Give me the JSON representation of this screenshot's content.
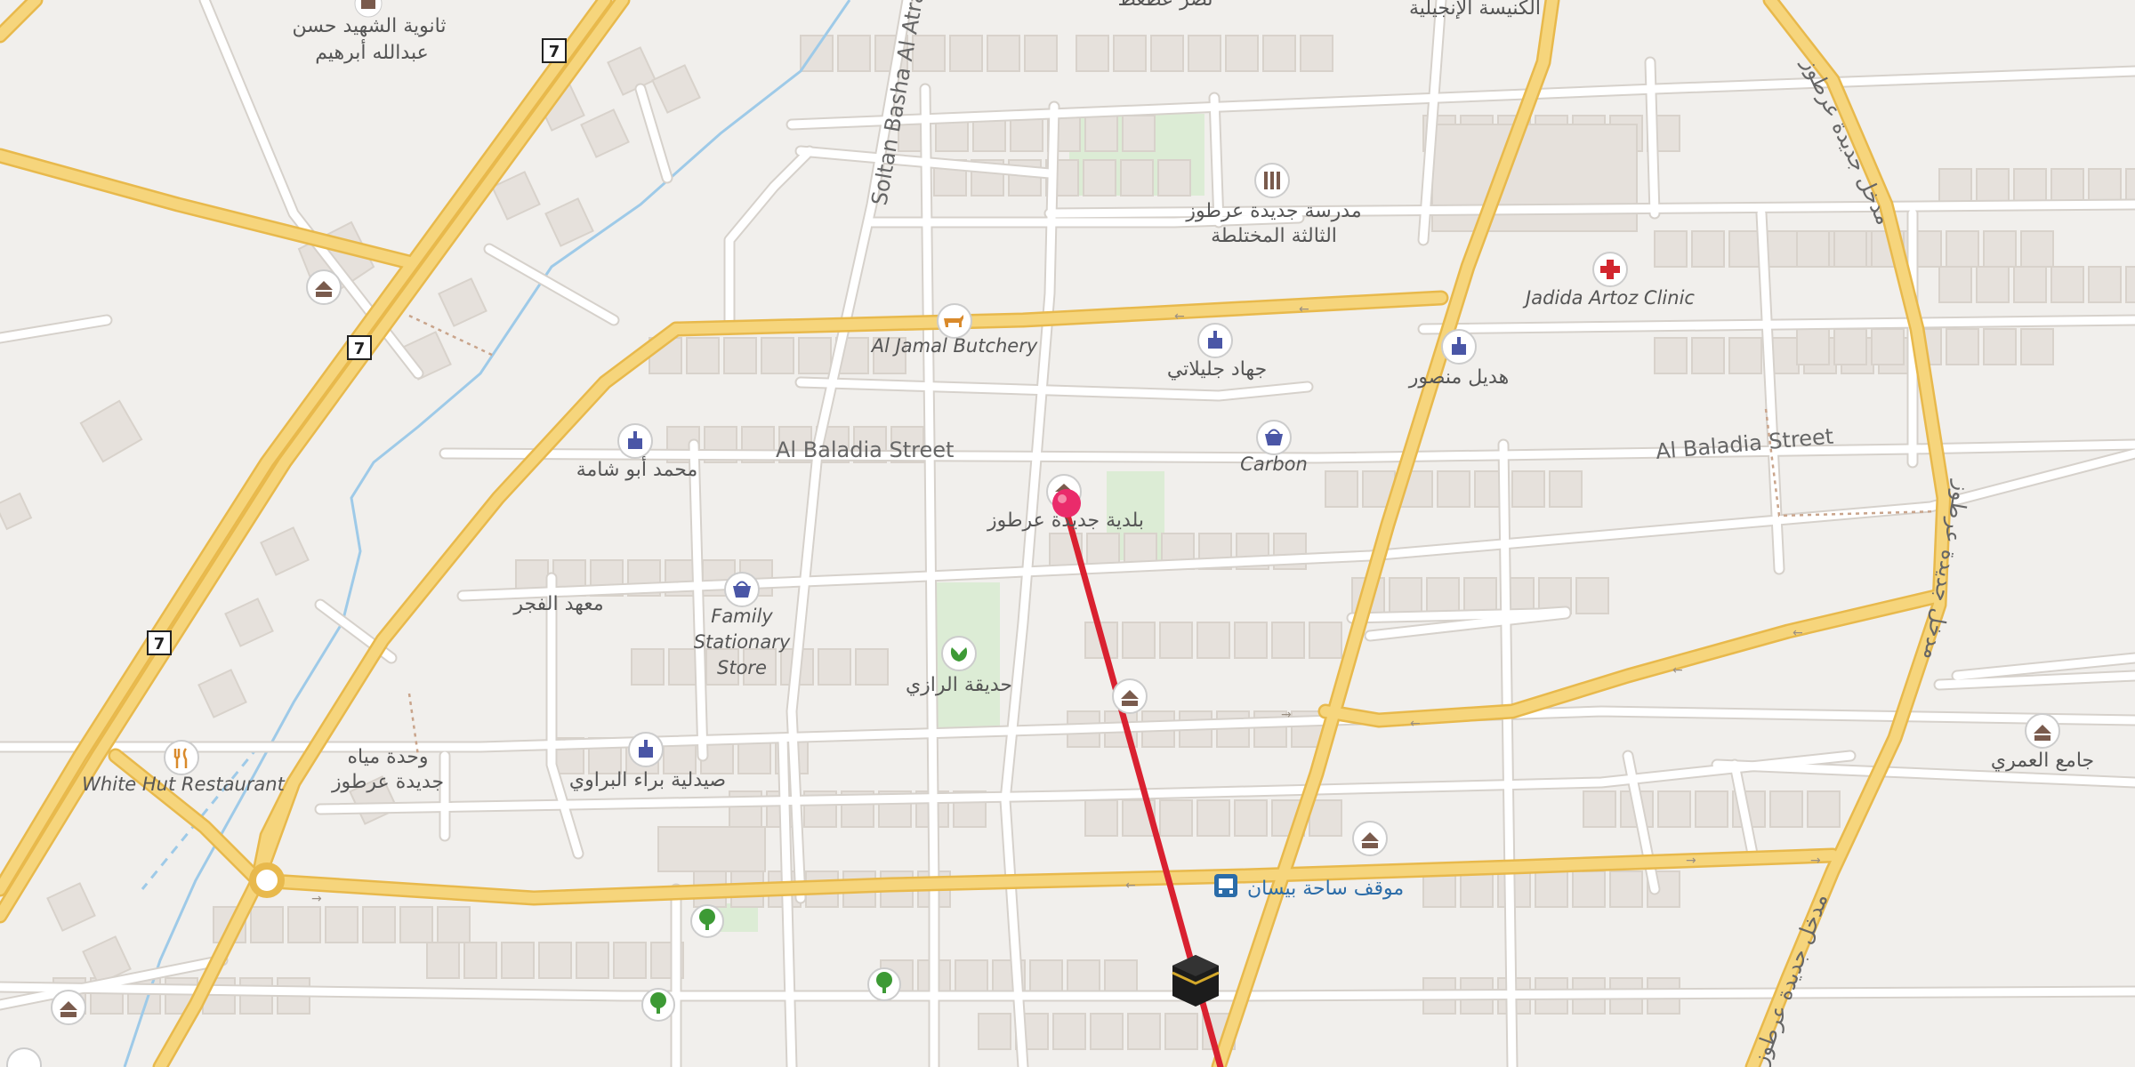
{
  "colors": {
    "background": "#f1efec",
    "building": "#e6e1dc",
    "building_stroke": "#d8d2cb",
    "park": "#dcecd5",
    "minor_road": "#ffffff",
    "major_road": "#f6d57c",
    "major_road_casing": "#e8b94c",
    "stream": "#9ecae8",
    "route_line": "#d92130",
    "pin": "#ea2b6b",
    "poi_blue": "#4a56a6",
    "poi_orange": "#d98a2b",
    "poi_green": "#3d9a35",
    "poi_red": "#d2262e",
    "poi_brown": "#7a5b4d"
  },
  "map": {
    "streets": {
      "soltan_basha": "Soltan Basha Al Atrash",
      "baladia_west": "Al Baladia Street",
      "baladia_east": "Al Baladia Street",
      "ring_north": "مدخل جديدة عرطوز",
      "ring_east": "مدخل جديدة عرطوز",
      "ring_south": "مدخل جديدة عرطوز"
    },
    "road_shields": [
      "7",
      "7",
      "7"
    ],
    "pois": {
      "school_hasan": [
        "ثانوية الشهيد حسن",
        "عبدالله أبرهيم"
      ],
      "church": "الكنيسة الإنجيلية",
      "school_third": [
        "مدرسة جديدة عرطوز",
        "الثالثة المختلطة"
      ],
      "clinic": "Jadida Artoz Clinic",
      "butchery": "Al Jamal Butchery",
      "jihad": "جهاد جليلاتي",
      "mansour": "هديل منصور",
      "abu_shama": "محمد أبو شامة",
      "carbon": "Carbon",
      "municipality": "بلدية جديدة عرطوز",
      "fajr": "معهد الفجر",
      "stationary": [
        "Family",
        "Stationary",
        "Store"
      ],
      "razi": "حديقة الرازي",
      "white_hut": "White Hut Restaurant",
      "water_unit": [
        "وحدة مياه",
        "جديدة عرطوز"
      ],
      "pharmacy_baraa": "صيدلية براء البراوي",
      "omari": "جامع العمري",
      "bus_stop": "موقف ساحة بيسان",
      "top_clipped": "نصر عطعط"
    },
    "icons": [
      "school-icon",
      "museum-icon",
      "hospital-icon",
      "butcher-icon",
      "pharmacy-icon",
      "shop-icon",
      "town-hall-icon",
      "garden-icon",
      "restaurant-icon",
      "bus-stop-icon",
      "kaaba-icon",
      "tree-icon",
      "location-pin-icon"
    ]
  }
}
